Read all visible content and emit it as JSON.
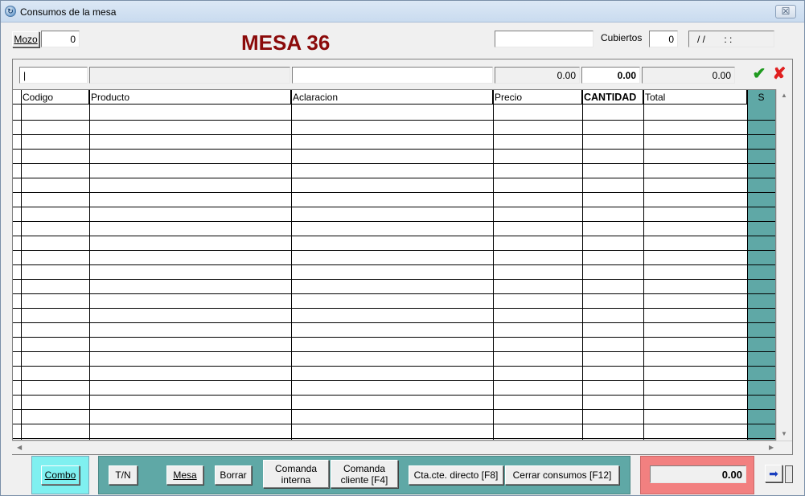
{
  "window": {
    "title": "Consumos de la mesa",
    "close_label": "☒"
  },
  "header": {
    "mozo_label": "Mozo",
    "mozo_value": "0",
    "mesa_title": "MESA 36",
    "name_value": "",
    "cubiertos_label": "Cubiertos",
    "cubiertos_value": "0",
    "datetime_value": "/ /       : :"
  },
  "entry": {
    "codigo": "|",
    "producto": "",
    "aclaracion": "",
    "precio": "0.00",
    "cantidad": "0.00",
    "total": "0.00"
  },
  "table": {
    "columns": [
      "Codigo",
      "Producto",
      "Aclaracion",
      "Precio",
      "CANTIDAD",
      "Total",
      "S"
    ]
  },
  "footer": {
    "combo": "Combo",
    "tn": "T/N",
    "mesa": "Mesa",
    "borrar": "Borrar",
    "comanda_interna_1": "Comanda",
    "comanda_interna_2": "interna",
    "comanda_cliente_1": "Comanda",
    "comanda_cliente_2": "cliente [F4]",
    "cta_cte": "Cta.cte. directo [F8]",
    "cerrar": "Cerrar consumos [F12]",
    "total": "0.00"
  },
  "colors": {
    "title_red": "#8b0a0a",
    "panel_teal": "#5fa8a6",
    "combo_cyan": "#7ff0f0",
    "total_pink": "#f28080"
  }
}
